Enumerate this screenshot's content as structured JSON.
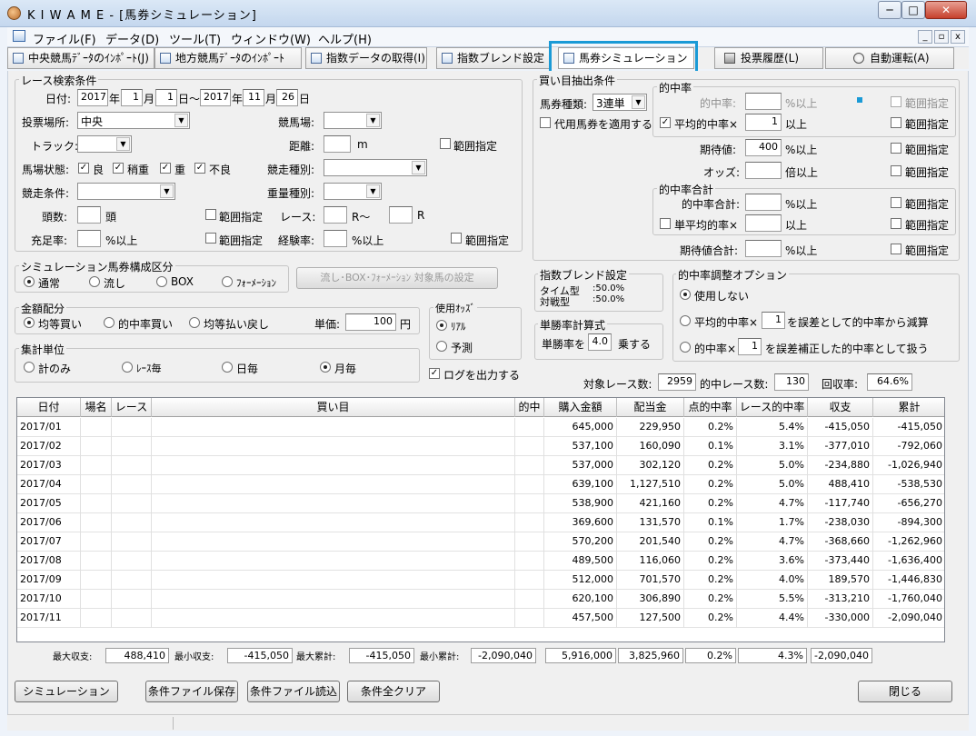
{
  "window": {
    "title": "K I W A M E - [馬券シミュレーション]",
    "min": "─",
    "max": "□",
    "close": "✕"
  },
  "menu": [
    "ファイル(F)",
    "データ(D)",
    "ツール(T)",
    "ウィンドウ(W)",
    "ヘルプ(H)"
  ],
  "tabs": [
    "中央競馬ﾃﾞｰﾀのｲﾝﾎﾟｰﾄ(J)",
    "地方競馬ﾃﾞｰﾀのｲﾝﾎﾟｰﾄ(N)",
    "指数データの取得(I)",
    "指数ブレンド設定(M)",
    "馬券シミュレーション(B)",
    "投票履歴(L)",
    "自動運転(A)"
  ],
  "race": {
    "title": "レース検索条件",
    "date_label": "日付:",
    "from_year": "2017",
    "from_month": "1",
    "from_day": "1",
    "to_year": "2017",
    "to_month": "11",
    "to_day": "26",
    "year": "年",
    "month": "月",
    "day": "日",
    "tilde": "日～",
    "day_end": "日",
    "venue_label": "投票場所:",
    "venue": "中央",
    "track_name_label": "競馬場:",
    "track_label": "トラック:",
    "distance_label": "距離:",
    "distance_unit": "m",
    "range": "範囲指定",
    "condition_label": "馬場状態:",
    "cond_good": "良",
    "cond_slight": "稍重",
    "cond_heavy": "重",
    "cond_bad": "不良",
    "race_type_label": "競走種別:",
    "race_cond_label": "競走条件:",
    "weight_type_label": "重量種別:",
    "heads_label": "頭数:",
    "heads_unit": "頭",
    "race_label": "レース:",
    "race_from": "R～",
    "race_to": "R",
    "fill_label": "充足率:",
    "fill_unit": "%以上",
    "exp_label": "経験率:",
    "exp_unit": "%以上"
  },
  "sim_bet": {
    "title": "シミュレーション馬券構成区分",
    "normal": "通常",
    "nagashi": "流し",
    "box": "BOX",
    "formation": "ﾌｫｰﾒｰｼｮﾝ",
    "target_button": "流し･BOX･ﾌｫｰﾒｰｼｮﾝ 対象馬の設定"
  },
  "money": {
    "title": "金額配分",
    "equal_buy": "均等買い",
    "hit_buy": "的中率買い",
    "equal_payout": "均等払い戻し",
    "unit_label": "単価:",
    "unit": "100",
    "yen": "円"
  },
  "aggregate": {
    "title": "集計単位",
    "total": "計のみ",
    "per_race": "ﾚｰｽ毎",
    "daily": "日毎",
    "monthly": "月毎"
  },
  "odds": {
    "title": "使用ｵｯｽﾞ",
    "real": "ﾘｱﾙ",
    "forecast": "予測"
  },
  "log_label": "ログを出力する",
  "buy": {
    "title": "買い目抽出条件",
    "bet_type_label": "馬券種類:",
    "bet_type": "3連単",
    "substitute": "代用馬券を適用する",
    "hit_title": "的中率",
    "hit_rate_label": "的中率:",
    "hit_rate_unit": "%以上",
    "avg_hit_label": "平均的中率×",
    "avg_hit": "1",
    "avg_hit_unit": "以上",
    "expect_label": "期待値:",
    "expect": "400",
    "expect_unit": "%以上",
    "odds_label": "オッズ:",
    "odds_unit": "倍以上",
    "total_title": "的中率合計",
    "total_hit_label": "的中率合計:",
    "total_hit_unit": "%以上",
    "single_avg_label": "単平均的率×",
    "single_avg_unit": "以上",
    "exp_total_label": "期待値合計:",
    "exp_total_unit": "%以上",
    "range": "範囲指定"
  },
  "blend": {
    "title": "指数ブレンド設定",
    "time_label": "タイム型",
    "time_val": ":50.0%",
    "match_label": "対戦型",
    "match_val": ":50.0%"
  },
  "win_rate": {
    "title": "単勝率計算式",
    "label": "単勝率を",
    "value": "4.0",
    "unit": "乗する"
  },
  "adjust": {
    "title": "的中率調整オプション",
    "none": "使用しない",
    "avg_label": "平均的中率×",
    "avg_val": "1",
    "avg_text": "を誤差として的中率から減算",
    "hit_label": "的中率×",
    "hit_val": "1",
    "hit_text": "を誤差補正した的中率として扱う"
  },
  "summary": {
    "target_label": "対象レース数:",
    "target": "2959",
    "hit_label": "的中レース数:",
    "hit": "130",
    "recovery_label": "回収率:",
    "recovery": "64.6%"
  },
  "table": {
    "headers": [
      "日付",
      "場名",
      "レース",
      "買い目",
      "的中",
      "購入金額",
      "配当金",
      "点的中率",
      "レース的中率",
      "収支",
      "累計"
    ],
    "rows": [
      [
        "2017/01",
        "",
        "",
        "",
        "",
        "645,000",
        "229,950",
        "0.2%",
        "5.4%",
        "-415,050",
        "-415,050"
      ],
      [
        "2017/02",
        "",
        "",
        "",
        "",
        "537,100",
        "160,090",
        "0.1%",
        "3.1%",
        "-377,010",
        "-792,060"
      ],
      [
        "2017/03",
        "",
        "",
        "",
        "",
        "537,000",
        "302,120",
        "0.2%",
        "5.0%",
        "-234,880",
        "-1,026,940"
      ],
      [
        "2017/04",
        "",
        "",
        "",
        "",
        "639,100",
        "1,127,510",
        "0.2%",
        "5.0%",
        "488,410",
        "-538,530"
      ],
      [
        "2017/05",
        "",
        "",
        "",
        "",
        "538,900",
        "421,160",
        "0.2%",
        "4.7%",
        "-117,740",
        "-656,270"
      ],
      [
        "2017/06",
        "",
        "",
        "",
        "",
        "369,600",
        "131,570",
        "0.1%",
        "1.7%",
        "-238,030",
        "-894,300"
      ],
      [
        "2017/07",
        "",
        "",
        "",
        "",
        "570,200",
        "201,540",
        "0.2%",
        "4.7%",
        "-368,660",
        "-1,262,960"
      ],
      [
        "2017/08",
        "",
        "",
        "",
        "",
        "489,500",
        "116,060",
        "0.2%",
        "3.6%",
        "-373,440",
        "-1,636,400"
      ],
      [
        "2017/09",
        "",
        "",
        "",
        "",
        "512,000",
        "701,570",
        "0.2%",
        "4.0%",
        "189,570",
        "-1,446,830"
      ],
      [
        "2017/10",
        "",
        "",
        "",
        "",
        "620,100",
        "306,890",
        "0.2%",
        "5.5%",
        "-313,210",
        "-1,760,040"
      ],
      [
        "2017/11",
        "",
        "",
        "",
        "",
        "457,500",
        "127,500",
        "0.2%",
        "4.4%",
        "-330,000",
        "-2,090,040"
      ]
    ]
  },
  "totals": {
    "max_profit_label": "最大収支:",
    "max_profit": "488,410",
    "min_profit_label": "最小収支:",
    "min_profit": "-415,050",
    "max_cum_label": "最大累計:",
    "max_cum": "-415,050",
    "min_cum_label": "最小累計:",
    "min_cum": "-2,090,040",
    "purchase": "5,916,000",
    "payout": "3,825,960",
    "point_hit": "0.2%",
    "race_hit": "4.3%",
    "profit": "-2,090,040"
  },
  "buttons": {
    "simulate": "シミュレーション",
    "save": "条件ファイル保存",
    "load": "条件ファイル読込",
    "clear": "条件全クリア",
    "close": "閉じる"
  },
  "colors": {
    "highlight": "#1a9ad6",
    "accent_dot": "#1a9ad6"
  }
}
